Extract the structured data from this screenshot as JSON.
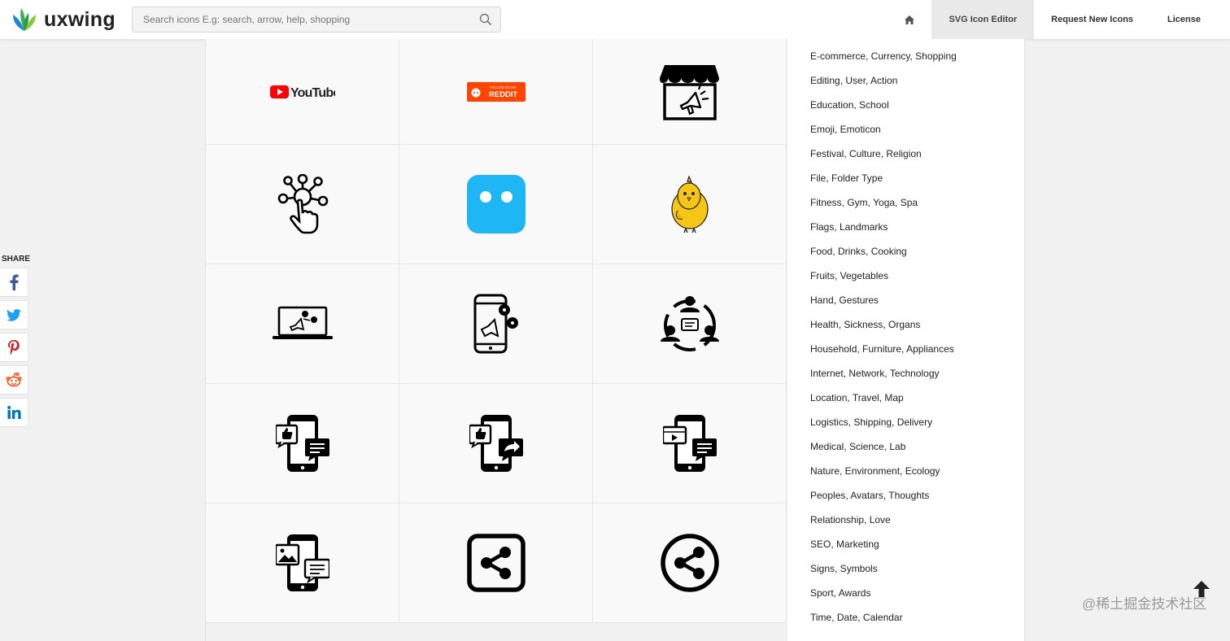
{
  "brand": {
    "name": "uxwing"
  },
  "search": {
    "placeholder": "Search icons E.g: search, arrow, help, shopping"
  },
  "nav": {
    "items": [
      {
        "label": "SVG Icon Editor"
      },
      {
        "label": "Request New Icons"
      },
      {
        "label": "License"
      }
    ]
  },
  "share": {
    "label": "SHARE",
    "networks": [
      "facebook",
      "twitter",
      "pinterest",
      "reddit",
      "linkedin"
    ]
  },
  "icons": [
    {
      "name": "youtube-logo-icon",
      "text": "YouTube"
    },
    {
      "name": "follow-us-on-reddit-icon",
      "top_text": "FOLLOW US ON",
      "text": "REDDIT"
    },
    {
      "name": "shop-megaphone-icon"
    },
    {
      "name": "network-hand-touch-icon"
    },
    {
      "name": "app-square-eyes-icon"
    },
    {
      "name": "koo-yellow-bird-icon"
    },
    {
      "name": "laptop-megaphone-icon"
    },
    {
      "name": "phone-megaphone-icon"
    },
    {
      "name": "people-circle-chat-icon"
    },
    {
      "name": "phone-like-chat-icon"
    },
    {
      "name": "phone-like-share-icon"
    },
    {
      "name": "phone-video-chat-icon"
    },
    {
      "name": "phone-image-chat-icon"
    },
    {
      "name": "share-square-icon"
    },
    {
      "name": "share-circle-icon"
    }
  ],
  "categories": [
    "E-commerce, Currency, Shopping",
    "Editing, User, Action",
    "Education, School",
    "Emoji, Emoticon",
    "Festival, Culture, Religion",
    "File, Folder Type",
    "Fitness, Gym, Yoga, Spa",
    "Flags, Landmarks",
    "Food, Drinks, Cooking",
    "Fruits, Vegetables",
    "Hand, Gestures",
    "Health, Sickness, Organs",
    "Household, Furniture, Appliances",
    "Internet, Network, Technology",
    "Location, Travel, Map",
    "Logistics, Shipping, Delivery",
    "Medical, Science, Lab",
    "Nature, Environment, Ecology",
    "Peoples, Avatars, Thoughts",
    "Relationship, Love",
    "SEO, Marketing",
    "Signs, Symbols",
    "Sport, Awards",
    "Time, Date, Calendar"
  ],
  "watermark": "@稀土掘金技术社区",
  "colors": {
    "youtube_red": "#ff0000",
    "reddit_orange": "#ff4500",
    "app_blue": "#1fb6f5",
    "bird_yellow": "#f5c518"
  }
}
